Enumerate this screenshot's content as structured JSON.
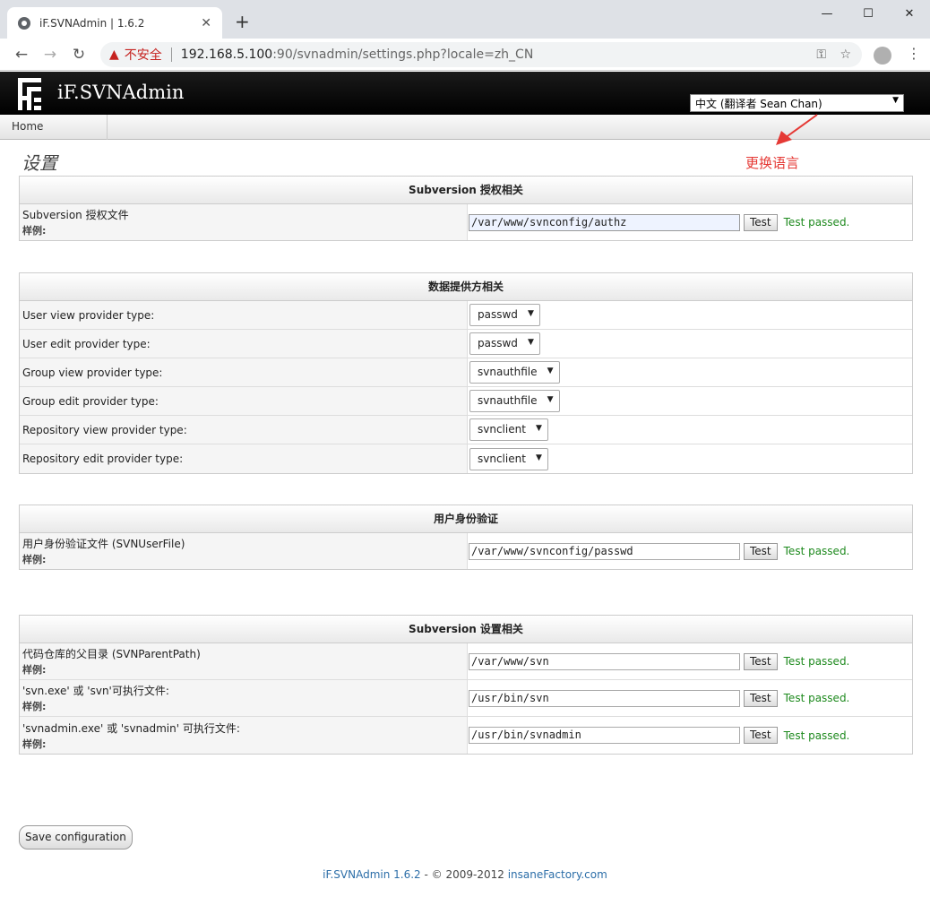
{
  "browser": {
    "tab_title": "iF.SVNAdmin | 1.6.2",
    "insecure_label": "不安全",
    "url_host": "192.168.5.100",
    "url_rest": ":90/svnadmin/settings.php?locale=zh_CN",
    "new_tab": "+",
    "close_tab": "✕"
  },
  "app": {
    "title": "iF.SVNAdmin",
    "language_selected": "中文 (翻译者 Sean Chan)",
    "nav_home": "Home"
  },
  "page": {
    "title": "设置",
    "annotation": "更换语言"
  },
  "sections": {
    "authz": {
      "header": "Subversion 授权相关",
      "row1": {
        "label": "Subversion 授权文件",
        "sub": "样例:",
        "value": "/var/www/svnconfig/authz",
        "button": "Test",
        "status": "Test passed."
      }
    },
    "providers": {
      "header": "数据提供方相关",
      "rows": [
        {
          "label": "User view provider type:",
          "value": "passwd"
        },
        {
          "label": "User edit provider type:",
          "value": "passwd"
        },
        {
          "label": "Group view provider type:",
          "value": "svnauthfile"
        },
        {
          "label": "Group edit provider type:",
          "value": "svnauthfile"
        },
        {
          "label": "Repository view provider type:",
          "value": "svnclient"
        },
        {
          "label": "Repository edit provider type:",
          "value": "svnclient"
        }
      ]
    },
    "auth": {
      "header": "用户身份验证",
      "row1": {
        "label": "用户身份验证文件 (SVNUserFile)",
        "sub": "样例:",
        "value": "/var/www/svnconfig/passwd",
        "button": "Test",
        "status": "Test passed."
      }
    },
    "svn": {
      "header": "Subversion 设置相关",
      "rows": [
        {
          "label": "代码仓库的父目录 (SVNParentPath)",
          "sub": "样例:",
          "value": "/var/www/svn",
          "button": "Test",
          "status": "Test passed."
        },
        {
          "label": "'svn.exe' 或 'svn'可执行文件:",
          "sub": "样例:",
          "value": "/usr/bin/svn",
          "button": "Test",
          "status": "Test passed."
        },
        {
          "label": "'svnadmin.exe' 或 'svnadmin' 可执行文件:",
          "sub": "样例:",
          "value": "/usr/bin/svnadmin",
          "button": "Test",
          "status": "Test passed."
        }
      ]
    }
  },
  "actions": {
    "save": "Save configuration"
  },
  "footer": {
    "product": "iF.SVNAdmin 1.6.2",
    "copyright": " - © 2009-2012 ",
    "company": "insaneFactory.com"
  },
  "colors": {
    "accent": "#e53935",
    "pass": "#1e8a1e",
    "link": "#2c6ea8"
  },
  "icons": [
    "globe-icon",
    "close-icon",
    "plus-icon",
    "minimize-icon",
    "maximize-icon",
    "window-close-icon",
    "back-icon",
    "forward-icon",
    "reload-icon",
    "warning-icon",
    "key-icon",
    "star-icon",
    "avatar-icon",
    "kebab-menu-icon",
    "dropdown-arrow-icon"
  ]
}
